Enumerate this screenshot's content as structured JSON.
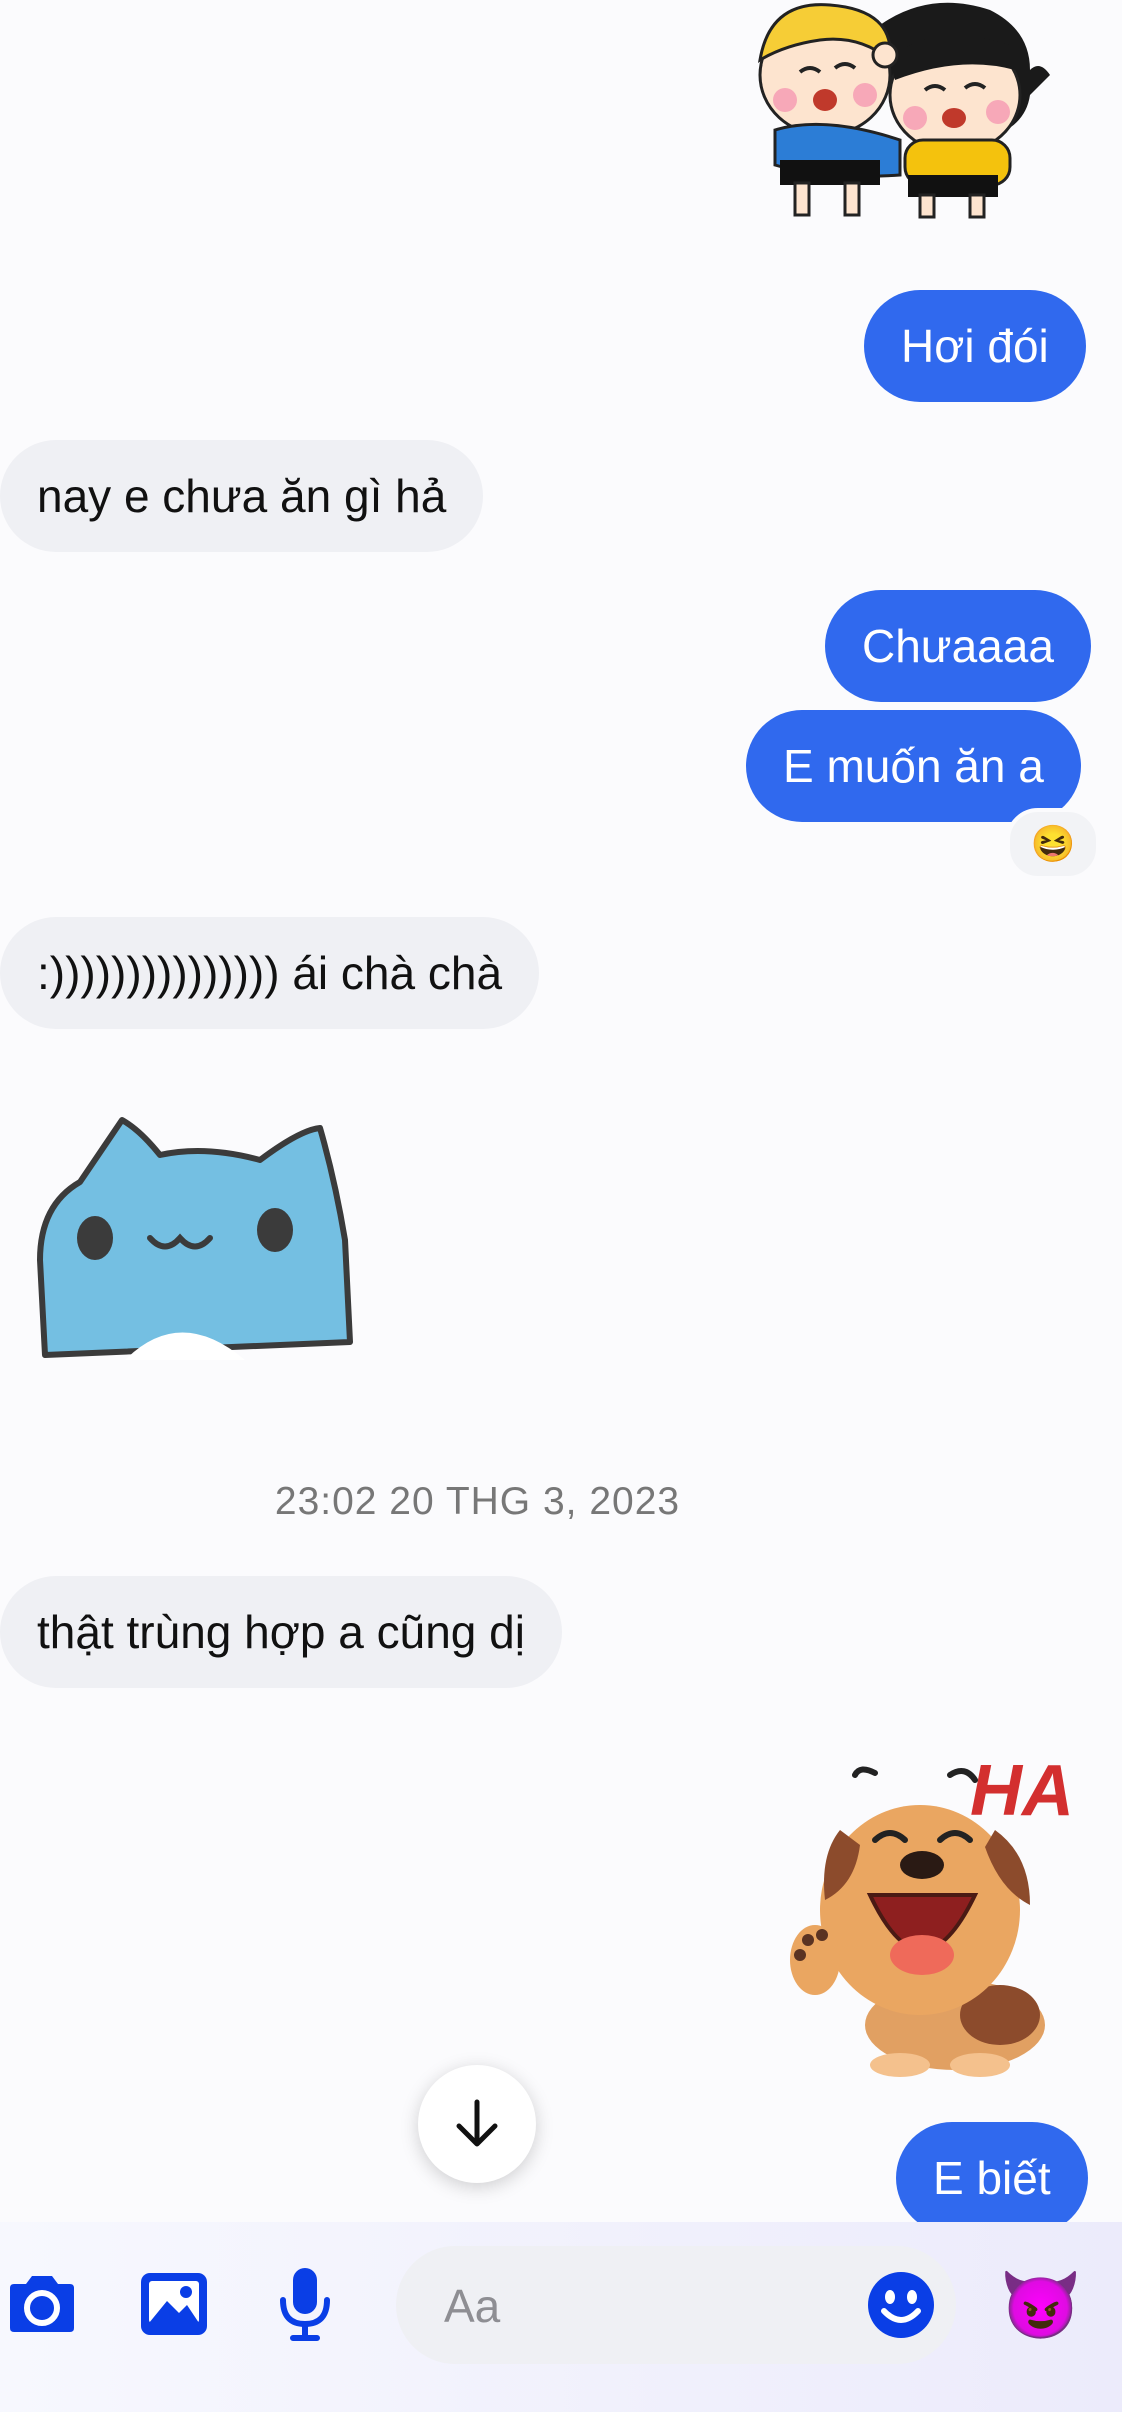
{
  "messages": {
    "m1": "Hơi đói",
    "m2": "nay e chưa ăn gì hả",
    "m3": "Chưaaaa",
    "m4": "E muốn ăn a",
    "m4_reaction": "😆",
    "m5": ":))))))))))))))) ái chà chà",
    "timestamp": "23:02 20 THG 3, 2023",
    "m6": "thật trùng hợp a cũng dị",
    "m7": "E biết",
    "sticker_ha_text": "HA"
  },
  "composer": {
    "placeholder": "Aa",
    "like_emoji": "😈"
  },
  "icons": [
    "camera-icon",
    "image-icon",
    "microphone-icon",
    "emoji-icon",
    "arrow-down-icon"
  ],
  "colors": {
    "outgoing_bubble": "#3069ee",
    "incoming_bubble": "#eff0f4",
    "composer_icons": "#0a3ee6"
  }
}
